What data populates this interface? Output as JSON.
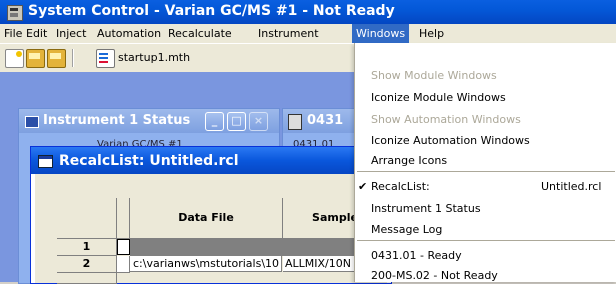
{
  "window": {
    "title": "System Control - Varian GC/MS #1 - Not Ready"
  },
  "menubar": {
    "items": [
      "File",
      "Edit",
      "Inject",
      "Automation",
      "Recalculate",
      "Instrument",
      "Windows",
      "Help"
    ],
    "active": "Windows"
  },
  "toolbar": {
    "method_file": "startup1.mth"
  },
  "instrument_window": {
    "title": "Instrument 1 Status",
    "subtitle": "Varian GC/MS #1"
  },
  "second_window": {
    "title": "0431",
    "subtitle": "0431.01"
  },
  "recalc_window": {
    "title": "RecalcList: Untitled.rcl",
    "columns": [
      "",
      "",
      "Data File",
      "Sample"
    ],
    "rows": [
      {
        "num": "1",
        "data_file": "",
        "sample": ""
      },
      {
        "num": "2",
        "data_file": "c:\\varianws\\mstutorials\\10",
        "sample": "ALLMIX/10N"
      }
    ]
  },
  "windows_menu": {
    "items": [
      {
        "label": "Show Module Windows",
        "disabled": true
      },
      {
        "label": "Iconize Module Windows",
        "disabled": false
      },
      {
        "label": "Show Automation Windows",
        "disabled": true
      },
      {
        "label": "Iconize Automation Windows",
        "disabled": false
      },
      {
        "label": "Arrange Icons",
        "disabled": false
      },
      {
        "label": "RecalcList:",
        "right": "Untitled.rcl",
        "checked": true
      },
      {
        "label": "Instrument 1 Status"
      },
      {
        "label": "Message Log"
      },
      {
        "label": "0431.01 - Ready"
      },
      {
        "label": "200-MS.02 - Not Ready"
      }
    ]
  },
  "colors": {
    "titlebar": "#0458d8",
    "menu_highlight": "#316ac5",
    "mdi_background": "#7a96df"
  }
}
